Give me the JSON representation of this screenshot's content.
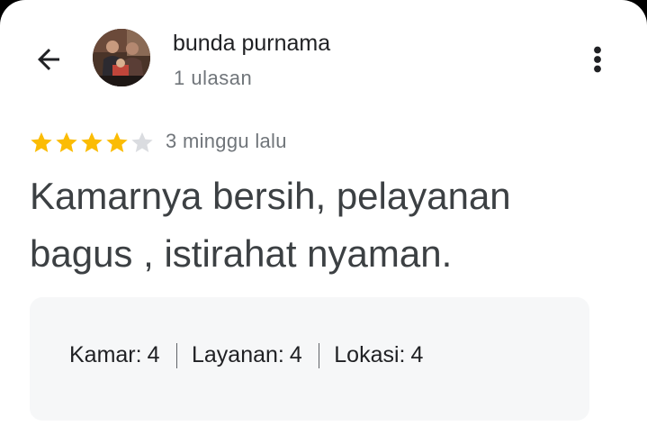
{
  "reviewer": {
    "name": "bunda purnama",
    "review_count": "1 ulasan"
  },
  "review": {
    "rating": 4,
    "max_rating": 5,
    "date": "3 minggu lalu",
    "text": "Kamarnya bersih, pelayanan bagus , istirahat nyaman."
  },
  "category_ratings": [
    {
      "label": "Kamar:",
      "value": "4"
    },
    {
      "label": "Layanan:",
      "value": "4"
    },
    {
      "label": "Lokasi:",
      "value": "4"
    }
  ],
  "colors": {
    "star_filled": "#fbbc04",
    "star_empty": "#dadce0",
    "text_primary": "#202124",
    "text_secondary": "#70757a",
    "ratings_box_bg": "#f6f7f8"
  },
  "icons": {
    "back": "arrow-left-icon",
    "more": "more-vert-icon"
  }
}
